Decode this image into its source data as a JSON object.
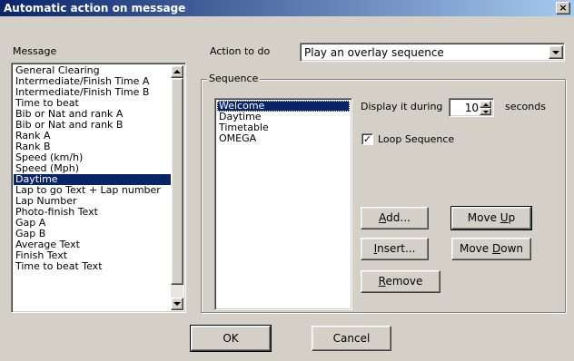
{
  "window": {
    "title": "Automatic action on message",
    "close_glyph": "×"
  },
  "message_label": "Message",
  "messages": [
    "General Clearing",
    "Intermediate/Finish Time A",
    "Intermediate/Finish Time B",
    "Time to beat",
    "Bib or Nat and rank A",
    "Bib or Nat and rank B",
    "Rank A",
    "Rank B",
    "Speed (km/h)",
    "Speed (Mph)",
    "Daytime",
    "Lap to go Text + Lap number",
    "Lap Number",
    "Photo-finish Text",
    "Gap A",
    "Gap B",
    "Average Text",
    "Finish Text",
    "Time to beat Text"
  ],
  "messages_selected_index": 10,
  "action": {
    "label": "Action to do",
    "selected": "Play an overlay sequence"
  },
  "sequence": {
    "group_label": "Sequence",
    "items": [
      "Welcome",
      "Daytime",
      "Timetable",
      "OMEGA"
    ],
    "selected_index": 0,
    "display_label": "Display it during",
    "display_value": "10",
    "seconds_label": "seconds",
    "loop_label": "Loop Sequence",
    "loop_checked": true,
    "check_glyph": "✓"
  },
  "buttons": {
    "add": {
      "pre": "",
      "key": "A",
      "post": "dd..."
    },
    "insert": {
      "pre": "",
      "key": "I",
      "post": "nsert..."
    },
    "remove": {
      "pre": "",
      "key": "R",
      "post": "emove"
    },
    "move_up": {
      "pre": "Move ",
      "key": "U",
      "post": "p"
    },
    "move_down": {
      "pre": "Move ",
      "key": "D",
      "post": "own"
    },
    "ok": "OK",
    "cancel": "Cancel"
  },
  "colors": {
    "face": "#d4d0c8",
    "selection": "#0a246a",
    "title_start": "#0a246a",
    "title_end": "#a6caf0"
  },
  "icons": {
    "close": "close-icon",
    "scroll_up": "arrow-up-icon",
    "scroll_down": "arrow-down-icon",
    "dropdown": "chevron-down-icon",
    "spin_up": "arrow-up-icon",
    "spin_down": "arrow-down-icon",
    "check": "checkmark-icon"
  }
}
